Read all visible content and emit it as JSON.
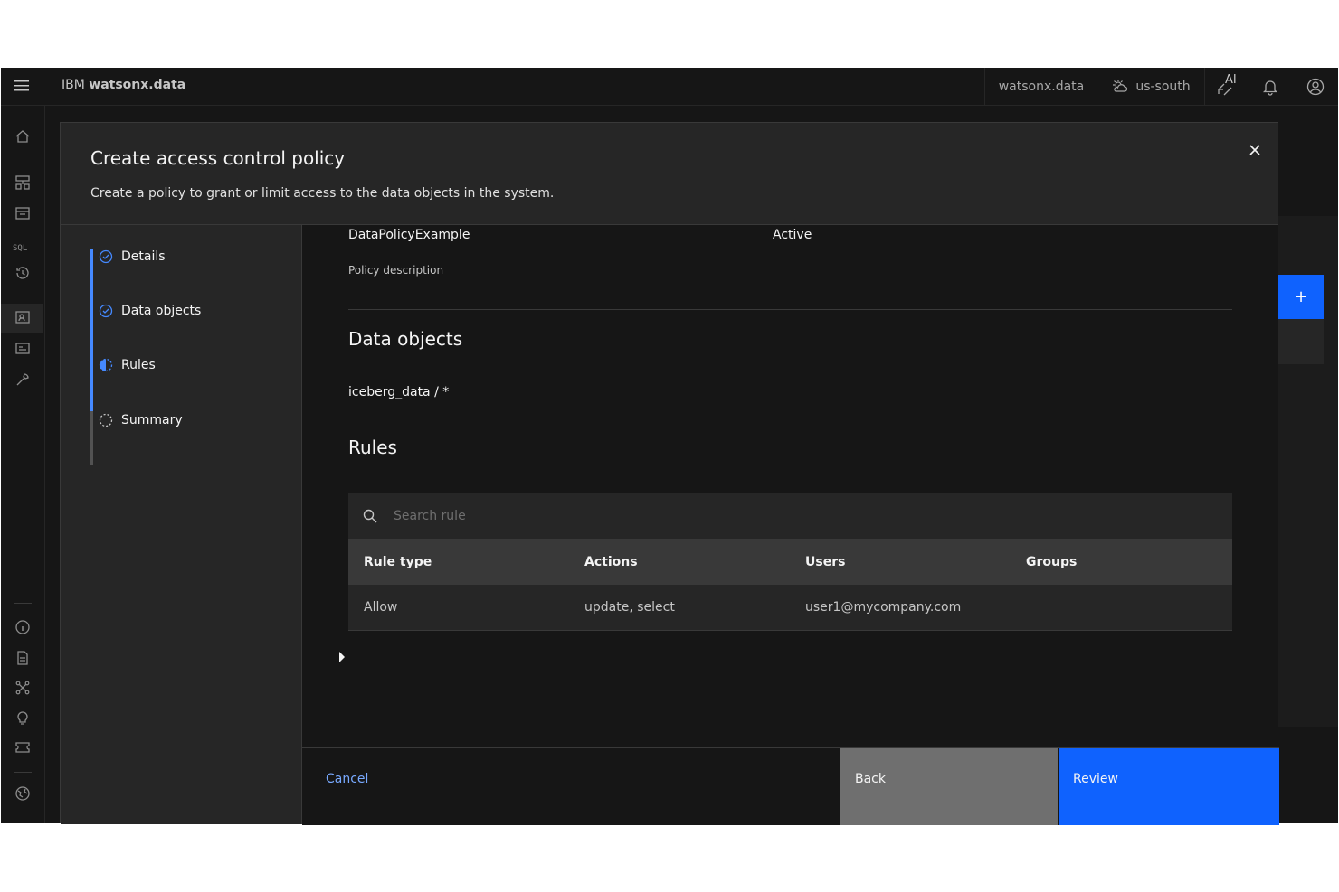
{
  "header": {
    "brand_prefix": "IBM",
    "brand_name": "watsonx.data",
    "instance": "watsonx.data",
    "region": "us-south",
    "ai_label": "AI"
  },
  "sidebar": {
    "icons": [
      "home-icon",
      "infrastructure-icon",
      "data-manager-icon",
      "sql-icon",
      "history-icon",
      "access-control-icon",
      "workspace-icon",
      "configurations-icon",
      "info-icon",
      "documentation-icon",
      "integrations-icon",
      "ideas-icon",
      "ticket-icon",
      "global-icon"
    ],
    "sql_label": "SQL"
  },
  "modal": {
    "title": "Create access control policy",
    "subtitle": "Create a policy to grant or limit access to the data objects in the system.",
    "steps": [
      {
        "label": "Details",
        "state": "complete"
      },
      {
        "label": "Data objects",
        "state": "complete"
      },
      {
        "label": "Rules",
        "state": "current"
      },
      {
        "label": "Summary",
        "state": "incomplete"
      }
    ],
    "policy": {
      "name": "DataPolicyExample",
      "status": "Active",
      "description_label": "Policy description"
    },
    "data_objects": {
      "title": "Data objects",
      "item": "iceberg_data / *"
    },
    "rules": {
      "title": "Rules",
      "search_placeholder": "Search rule",
      "columns": [
        "Rule type",
        "Actions",
        "Users",
        "Groups"
      ],
      "rows": [
        {
          "rule_type": "Allow",
          "actions": "update, select",
          "users": "user1@mycompany.com",
          "groups": ""
        }
      ]
    },
    "footer": {
      "cancel": "Cancel",
      "back": "Back",
      "review": "Review"
    }
  },
  "background": {
    "add_button": "+"
  },
  "colors": {
    "accent": "#0f62fe",
    "step_line": "#4589ff",
    "link": "#78a9ff"
  }
}
